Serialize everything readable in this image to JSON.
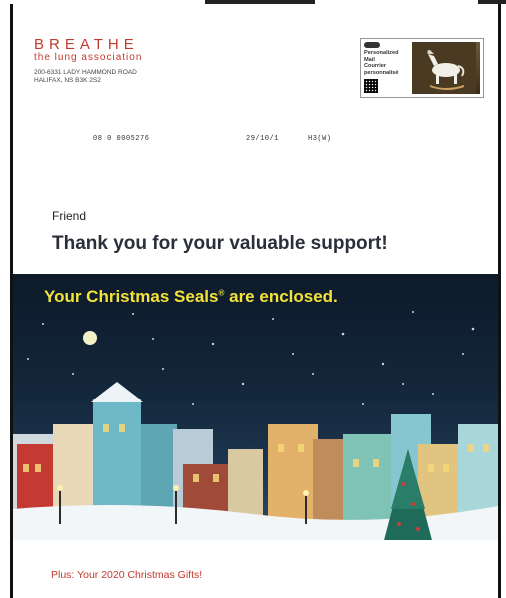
{
  "sender": {
    "brand": "BREATHE",
    "tagline": "the lung association",
    "address_line1": "200-6331 LADY HAMMOND ROAD",
    "address_line2": "HALIFAX, NS  B3K 2S2"
  },
  "postage": {
    "line1": "Personalized",
    "line2": "Mail",
    "line3": "Courrier",
    "line4": "personnalisé"
  },
  "codes": {
    "left": "08  0 0005276",
    "middle": "29/10/1",
    "right": "H3(W)"
  },
  "letter": {
    "greeting": "Friend",
    "thanks": "Thank you for your valuable support!"
  },
  "banner": {
    "headline": "Your Christmas Seals",
    "headline_mark": "®",
    "headline_tail": " are enclosed."
  },
  "footer": {
    "gifts": "Plus: Your 2020 Christmas Gifts!"
  },
  "colors": {
    "brand_red": "#c23a2e",
    "headline_yellow": "#f2e23a",
    "sky": "#13263a"
  }
}
